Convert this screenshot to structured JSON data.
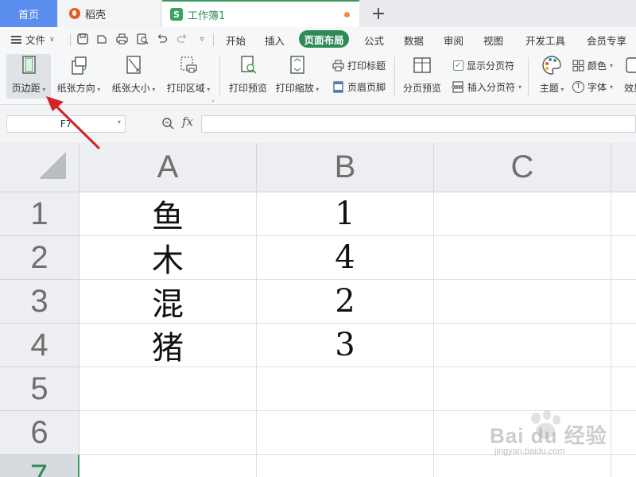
{
  "tabs": {
    "home": "首页",
    "daoke": "稻壳",
    "workbook": "工作簿1",
    "workbook_icon": "S",
    "add": "+"
  },
  "menubar": {
    "file": "文件",
    "items": [
      "开始",
      "插入",
      "页面布局",
      "公式",
      "数据",
      "审阅",
      "视图",
      "开发工具",
      "会员专享"
    ],
    "active": "页面布局"
  },
  "ribbon": {
    "margins": "页边距",
    "orientation": "纸张方向",
    "size": "纸张大小",
    "print_area": "打印区域",
    "print_preview": "打印预览",
    "print_scale": "打印缩放",
    "print_titles": "打印标题",
    "header_footer": "页眉页脚",
    "page_break_preview": "分页预览",
    "show_page_breaks": "显示分页符",
    "insert_page_break": "插入分页符",
    "theme": "主题",
    "colors": "颜色",
    "fonts": "字体",
    "effects": "效果"
  },
  "formula_bar": {
    "cell_ref": "F7",
    "fx": "fx",
    "value": ""
  },
  "sheet": {
    "columns": [
      "A",
      "B",
      "C"
    ],
    "rows": [
      "1",
      "2",
      "3",
      "4",
      "5",
      "6",
      "7"
    ],
    "data": [
      [
        "鱼",
        "1",
        ""
      ],
      [
        "木",
        "4",
        ""
      ],
      [
        "混",
        "2",
        ""
      ],
      [
        "猪",
        "3",
        ""
      ],
      [
        "",
        "",
        ""
      ],
      [
        "",
        "",
        ""
      ],
      [
        "",
        "",
        ""
      ]
    ],
    "selected_row": "7"
  },
  "watermark": {
    "brand": "Bai du 经验",
    "url": "jingyan.baidu.com"
  },
  "colors": {
    "accent_green": "#2e8b57",
    "home_tab_blue": "#5b8def",
    "annotation_red": "#d42424"
  }
}
